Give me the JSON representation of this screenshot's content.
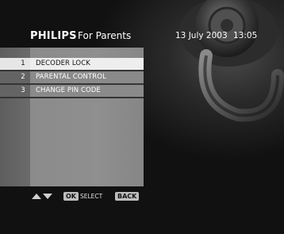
{
  "header": {
    "brand": "PHILIPS",
    "title": "For Parents",
    "date": "13 July 2003",
    "time": "13:05"
  },
  "menu": {
    "items": [
      {
        "number": "1",
        "label": "DECODER LOCK",
        "selected": true
      },
      {
        "number": "2",
        "label": "PARENTAL CONTROL",
        "selected": false
      },
      {
        "number": "3",
        "label": "CHANGE PIN CODE",
        "selected": false
      }
    ]
  },
  "footer": {
    "navigate_icon": "up-down-arrows-icon",
    "ok_key": "OK",
    "ok_label": "SELECT",
    "back_key": "BACK"
  },
  "colors": {
    "selected_row": "#eeeeee",
    "menu_panel": "#8b8b8b",
    "background": "#0d0d0d"
  }
}
